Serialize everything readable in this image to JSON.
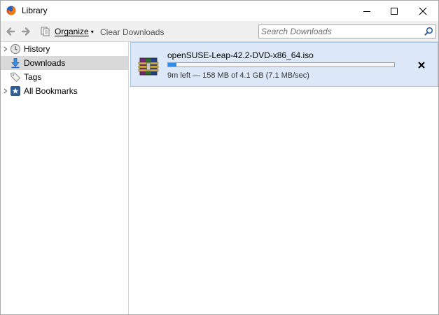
{
  "window": {
    "title": "Library",
    "controls": {
      "minimize": "minimize-icon",
      "maximize": "maximize-icon",
      "close": "close-icon"
    }
  },
  "toolbar": {
    "back_icon": "back-arrow-icon",
    "forward_icon": "forward-arrow-icon",
    "organize_label": "Organize",
    "clear_label": "Clear Downloads",
    "search_placeholder": "Search Downloads"
  },
  "sidebar": {
    "items": [
      {
        "label": "History",
        "icon": "clock-icon",
        "expandable": true,
        "selected": false
      },
      {
        "label": "Downloads",
        "icon": "download-arrow-icon",
        "expandable": false,
        "selected": true
      },
      {
        "label": "Tags",
        "icon": "tag-icon",
        "expandable": false,
        "selected": false
      },
      {
        "label": "All Bookmarks",
        "icon": "star-icon",
        "expandable": true,
        "selected": false
      }
    ]
  },
  "downloads": [
    {
      "filename": "openSUSE-Leap-42.2-DVD-x86_64.iso",
      "status": "9m left — 158 MB of 4.1 GB (7.1 MB/sec)",
      "progress": 0.038,
      "icon": "archive-file-icon"
    }
  ],
  "colors": {
    "selected_sidebar": "#d9d9d9",
    "download_row_bg": "#dce8f7",
    "progress_fill": "#2f8be6"
  }
}
